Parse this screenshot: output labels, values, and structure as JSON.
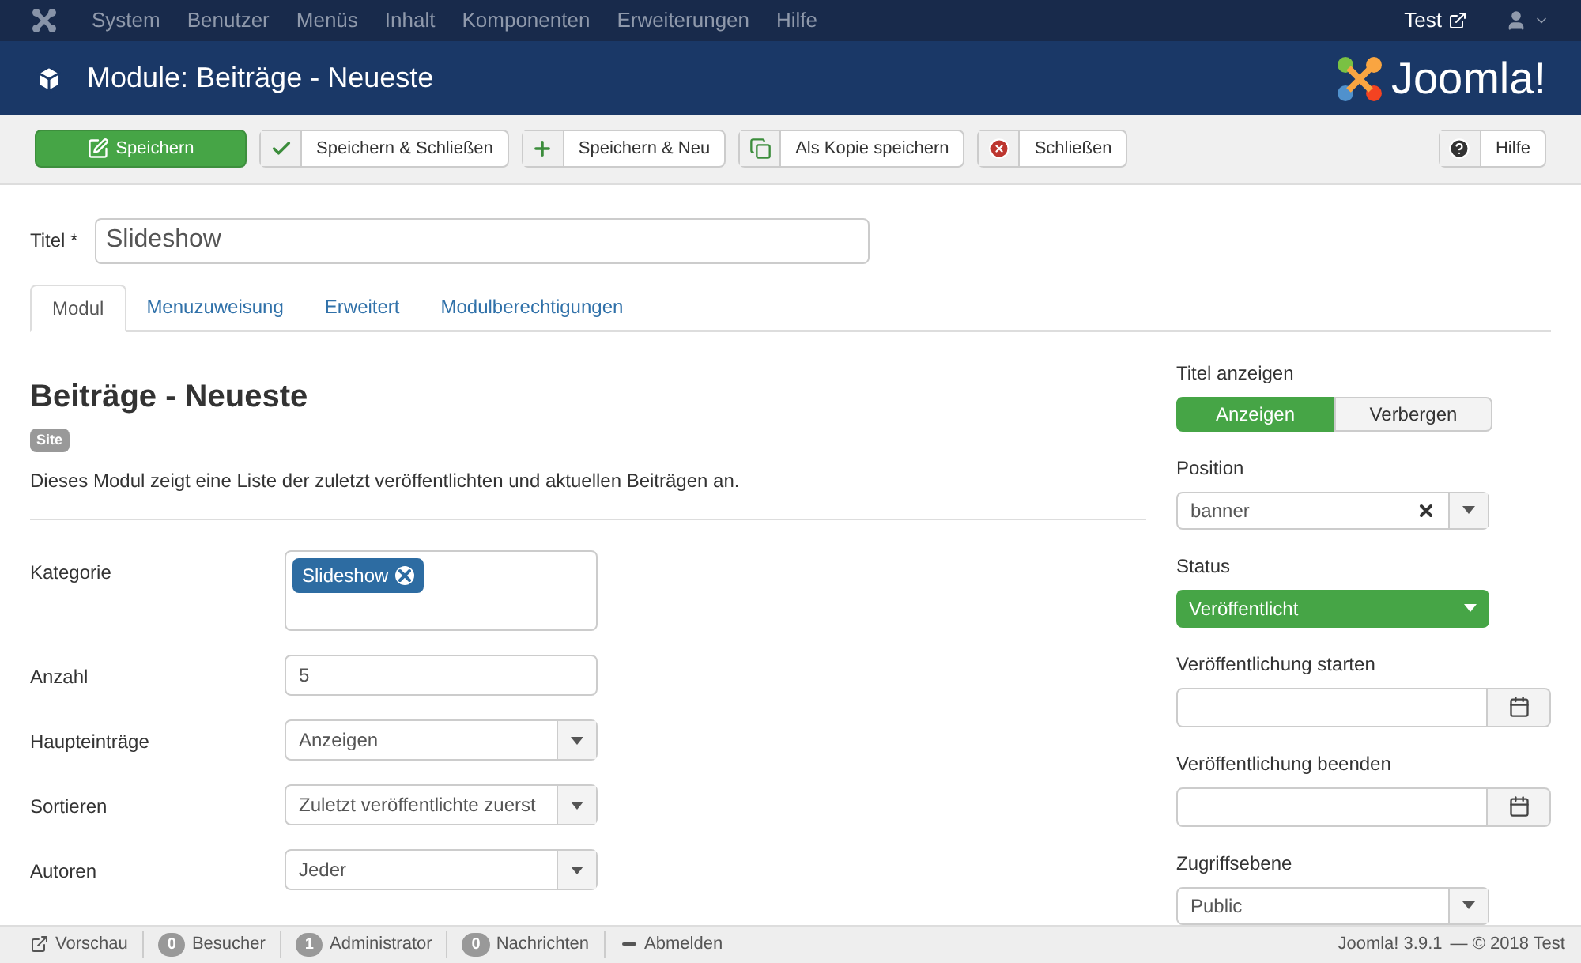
{
  "topnav": {
    "menu": [
      "System",
      "Benutzer",
      "Menüs",
      "Inhalt",
      "Komponenten",
      "Erweiterungen",
      "Hilfe"
    ],
    "site_link": "Test"
  },
  "header": {
    "title": "Module: Beiträge - Neueste",
    "logo_text": "Joomla!"
  },
  "toolbar": {
    "buttons": [
      {
        "label": "Speichern",
        "kind": "save"
      },
      {
        "label": "Speichern & Schließen",
        "kind": "save-close"
      },
      {
        "label": "Speichern & Neu",
        "kind": "save-new"
      },
      {
        "label": "Als Kopie speichern",
        "kind": "save-copy"
      },
      {
        "label": "Schließen",
        "kind": "close"
      }
    ],
    "help": {
      "label": "Hilfe"
    }
  },
  "title_field": {
    "label": "Titel *",
    "value": "Slideshow"
  },
  "tabs": [
    {
      "label": "Modul",
      "selected": true
    },
    {
      "label": "Menuzuweisung",
      "selected": false
    },
    {
      "label": "Erweitert",
      "selected": false
    },
    {
      "label": "Modulberechtigungen",
      "selected": false
    }
  ],
  "module": {
    "heading": "Beiträge - Neueste",
    "badge": "Site",
    "description": "Dieses Modul zeigt eine Liste der zuletzt veröffentlichten und aktuellen Beiträgen an."
  },
  "fields": [
    {
      "label": "Kategorie",
      "kind": "tags",
      "tags": [
        "Slideshow"
      ]
    },
    {
      "label": "Anzahl",
      "kind": "text",
      "value": "5"
    },
    {
      "label": "Haupteinträge",
      "kind": "select",
      "value": "Anzeigen"
    },
    {
      "label": "Sortieren",
      "kind": "select",
      "value": "Zuletzt veröffentlichte zuerst"
    },
    {
      "label": "Autoren",
      "kind": "select",
      "value": "Jeder"
    }
  ],
  "sidebar": [
    {
      "label": "Titel anzeigen",
      "kind": "toggle",
      "options": [
        {
          "label": "Anzeigen",
          "selected": true
        },
        {
          "label": "Verbergen",
          "selected": false
        }
      ]
    },
    {
      "label": "Position",
      "kind": "clearable",
      "value": "banner"
    },
    {
      "label": "Status",
      "kind": "status",
      "value": "Veröffentlicht"
    },
    {
      "label": "Veröffentlichung starten",
      "kind": "date"
    },
    {
      "label": "Veröffentlichung beenden",
      "kind": "date"
    },
    {
      "label": "Zugriffsebene",
      "kind": "select",
      "value": "Public"
    }
  ],
  "status_bar": {
    "items": [
      {
        "kind": "link",
        "label": "Vorschau"
      },
      {
        "kind": "badge",
        "count": "0",
        "label": "Besucher"
      },
      {
        "kind": "badge",
        "count": "1",
        "label": "Administrator"
      },
      {
        "kind": "badge",
        "count": "0",
        "label": "Nachrichten"
      },
      {
        "kind": "logout",
        "label": "Abmelden"
      }
    ],
    "version": "Joomla! 3.9.1",
    "copyright": "— © 2018 Test"
  }
}
